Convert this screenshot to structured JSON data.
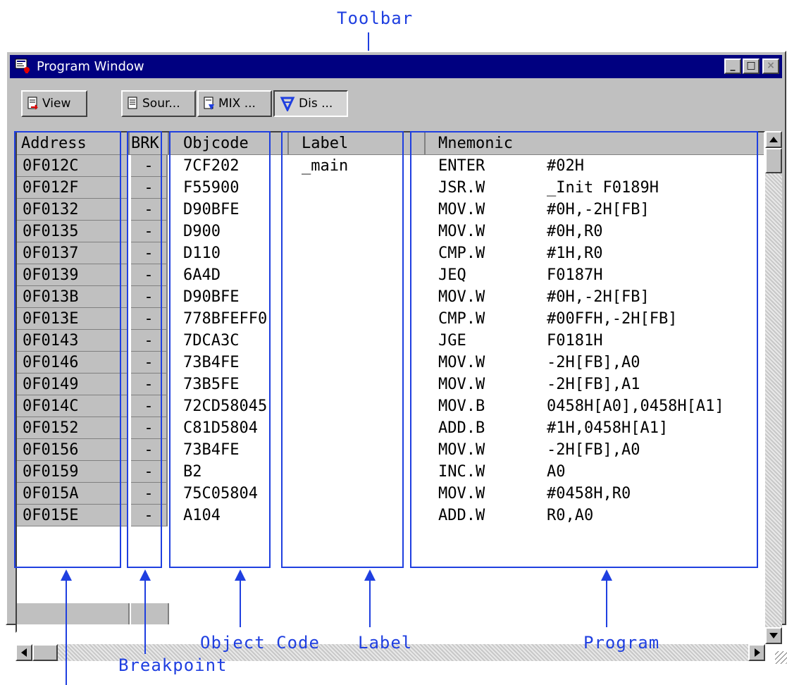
{
  "callouts": {
    "toolbar": "Toolbar",
    "object_code": "Object Code",
    "label": "Label",
    "program": "Program",
    "breakpoint": "Breakpoint"
  },
  "window": {
    "title": "Program Window",
    "minimize": "_",
    "maximize": "□",
    "close": "×"
  },
  "toolbar": {
    "view_label": "View",
    "source_label": "Sour...",
    "mix_label": "MIX ...",
    "dis_label": "Dis ..."
  },
  "columns": {
    "address": "Address",
    "brk": "BRK",
    "objcode": "Objcode",
    "label": "Label",
    "mnemonic": "Mnemonic"
  },
  "rows": [
    {
      "address": "0F012C",
      "brk": "-",
      "objcode": "7CF202",
      "label": "_main",
      "mnemonic": "ENTER",
      "operand": "#02H"
    },
    {
      "address": "0F012F",
      "brk": "-",
      "objcode": "F55900",
      "label": "",
      "mnemonic": "JSR.W",
      "operand": "_Init F0189H"
    },
    {
      "address": "0F0132",
      "brk": "-",
      "objcode": "D90BFE",
      "label": "",
      "mnemonic": "MOV.W",
      "operand": "#0H,-2H[FB]"
    },
    {
      "address": "0F0135",
      "brk": "-",
      "objcode": "D900",
      "label": "",
      "mnemonic": "MOV.W",
      "operand": "#0H,R0"
    },
    {
      "address": "0F0137",
      "brk": "-",
      "objcode": "D110",
      "label": "",
      "mnemonic": "CMP.W",
      "operand": "#1H,R0"
    },
    {
      "address": "0F0139",
      "brk": "-",
      "objcode": "6A4D",
      "label": "",
      "mnemonic": "JEQ",
      "operand": "F0187H"
    },
    {
      "address": "0F013B",
      "brk": "-",
      "objcode": "D90BFE",
      "label": "",
      "mnemonic": "MOV.W",
      "operand": "#0H,-2H[FB]"
    },
    {
      "address": "0F013E",
      "brk": "-",
      "objcode": "778BFEFF0",
      "label": "",
      "mnemonic": "CMP.W",
      "operand": "#00FFH,-2H[FB]"
    },
    {
      "address": "0F0143",
      "brk": "-",
      "objcode": "7DCA3C",
      "label": "",
      "mnemonic": "JGE",
      "operand": "F0181H"
    },
    {
      "address": "0F0146",
      "brk": "-",
      "objcode": "73B4FE",
      "label": "",
      "mnemonic": "MOV.W",
      "operand": "-2H[FB],A0"
    },
    {
      "address": "0F0149",
      "brk": "-",
      "objcode": "73B5FE",
      "label": "",
      "mnemonic": "MOV.W",
      "operand": "-2H[FB],A1"
    },
    {
      "address": "0F014C",
      "brk": "-",
      "objcode": "72CD58045",
      "label": "",
      "mnemonic": "MOV.B",
      "operand": "0458H[A0],0458H[A1]"
    },
    {
      "address": "0F0152",
      "brk": "-",
      "objcode": "C81D5804",
      "label": "",
      "mnemonic": "ADD.B",
      "operand": "#1H,0458H[A1]"
    },
    {
      "address": "0F0156",
      "brk": "-",
      "objcode": "73B4FE",
      "label": "",
      "mnemonic": "MOV.W",
      "operand": "-2H[FB],A0"
    },
    {
      "address": "0F0159",
      "brk": "-",
      "objcode": "B2",
      "label": "",
      "mnemonic": "INC.W",
      "operand": "A0"
    },
    {
      "address": "0F015A",
      "brk": "-",
      "objcode": "75C05804",
      "label": "",
      "mnemonic": "MOV.W",
      "operand": "#0458H,R0"
    },
    {
      "address": "0F015E",
      "brk": "-",
      "objcode": "A104",
      "label": "",
      "mnemonic": "ADD.W",
      "operand": "R0,A0"
    }
  ],
  "colors": {
    "annotation": "#1f3fe0",
    "titlebar": "#000080",
    "panel": "#c0c0c0"
  }
}
